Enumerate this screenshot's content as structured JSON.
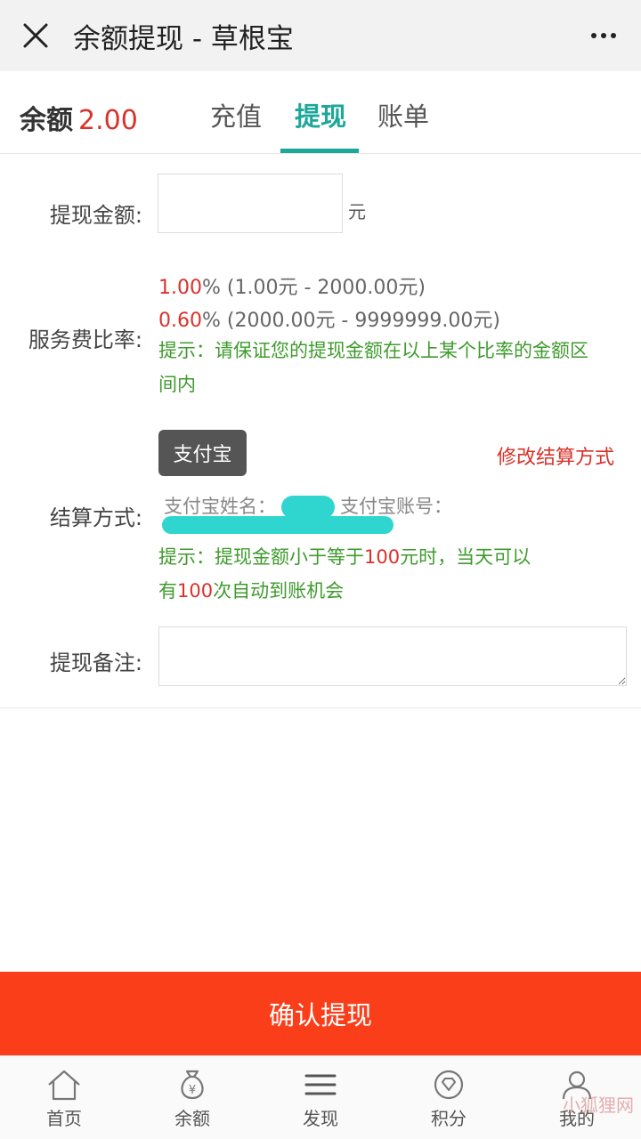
{
  "titlebar": {
    "title": "余额提现 - 草根宝",
    "close_icon": "close-icon",
    "more_icon": "more-icon"
  },
  "tabs_bar": {
    "balance_label": "余额",
    "balance_value": "2.00",
    "tabs": [
      {
        "label": "充值",
        "active": false
      },
      {
        "label": "提现",
        "active": true
      },
      {
        "label": "账单",
        "active": false
      }
    ]
  },
  "form": {
    "amount_label": "提现金额:",
    "amount_value": "",
    "amount_unit": "元",
    "fee_label": "服务费比率:",
    "fee_rates": [
      {
        "pct": "1.00",
        "suffix": "% (1.00元 - 2000.00元)"
      },
      {
        "pct": "0.60",
        "suffix": "% (2000.00元 - 9999999.00元)"
      }
    ],
    "fee_hint_1": "提示：请保证您的提现金额在以上某个比率的金额区",
    "fee_hint_2": "间内",
    "settlement_label": "结算方式:",
    "settlement_button": "支付宝",
    "change_settlement": "修改结算方式",
    "alipay_name_label": "支付宝姓名：",
    "alipay_account_label": "支付宝账号：",
    "settle_hint_line1_a": "提示：提现金额小于等于",
    "settle_hint_line1_b": "100",
    "settle_hint_line1_c": "元时，当天可以",
    "settle_hint_line2_a": "有",
    "settle_hint_line2_b": "100",
    "settle_hint_line2_c": "次自动到账机会",
    "remark_label": "提现备注:",
    "remark_value": ""
  },
  "confirm_button": "确认提现",
  "bottom_nav": [
    {
      "label": "首页",
      "icon": "home-icon"
    },
    {
      "label": "余额",
      "icon": "money-bag-icon"
    },
    {
      "label": "发现",
      "icon": "menu-icon"
    },
    {
      "label": "积分",
      "icon": "points-icon"
    },
    {
      "label": "我的",
      "icon": "user-icon"
    }
  ],
  "watermark": "小狐狸网",
  "colors": {
    "accent": "#1ca79a",
    "danger": "#d9322b",
    "hint_green": "#3f9b2d",
    "confirm_bg": "#fa3e1a",
    "masked": "#2fd6cf"
  }
}
